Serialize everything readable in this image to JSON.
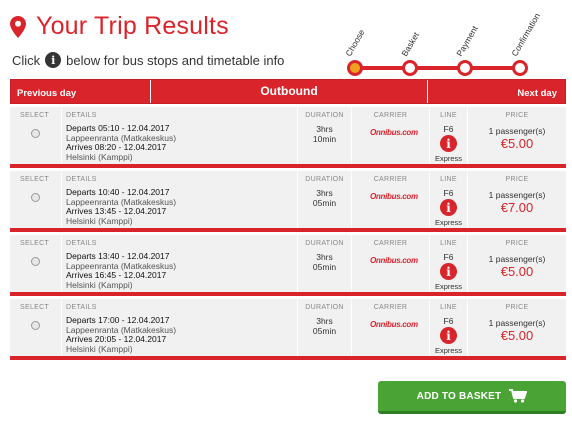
{
  "page": {
    "title": "Your Trip Results",
    "hint_before": "Click",
    "hint_after": "below for bus stops and timetable info",
    "hint_icon": "info-icon"
  },
  "progress": {
    "steps": [
      "Choose",
      "Basket",
      "Payment",
      "Confirmation"
    ],
    "active_step": "Choose",
    "accent": "#d9242b",
    "active_fill": "#f0a020"
  },
  "nav": {
    "prev": "Previous day",
    "title": "Outbound",
    "next": "Next day"
  },
  "headers": {
    "select": "SELECT",
    "details": "DETAILS",
    "duration": "DURATION",
    "carrier": "CARRIER",
    "line": "LINE",
    "price": "PRICE"
  },
  "trips": [
    {
      "depart": "Departs 05:10 - 12.04.2017",
      "from": "Lappeenranta (Matkakeskus)",
      "arrive": "Arrives 08:20 - 12.04.2017",
      "to": "Helsinki (Kamppi)",
      "dur_h": "3hrs",
      "dur_m": "10min",
      "carrier": "Onnibus.com",
      "line": "F6",
      "type": "Express",
      "pax": "1 passenger(s)",
      "price": "€5.00"
    },
    {
      "depart": "Departs 10:40 - 12.04.2017",
      "from": "Lappeenranta (Matkakeskus)",
      "arrive": "Arrives 13:45 - 12.04.2017",
      "to": "Helsinki (Kamppi)",
      "dur_h": "3hrs",
      "dur_m": "05min",
      "carrier": "Onnibus.com",
      "line": "F6",
      "type": "Express",
      "pax": "1 passenger(s)",
      "price": "€7.00"
    },
    {
      "depart": "Departs 13:40 - 12.04.2017",
      "from": "Lappeenranta (Matkakeskus)",
      "arrive": "Arrives 16:45 - 12.04.2017",
      "to": "Helsinki (Kamppi)",
      "dur_h": "3hrs",
      "dur_m": "05min",
      "carrier": "Onnibus.com",
      "line": "F6",
      "type": "Express",
      "pax": "1 passenger(s)",
      "price": "€5.00"
    },
    {
      "depart": "Departs 17:00 - 12.04.2017",
      "from": "Lappeenranta (Matkakeskus)",
      "arrive": "Arrives 20:05 - 12.04.2017",
      "to": "Helsinki (Kamppi)",
      "dur_h": "3hrs",
      "dur_m": "05min",
      "carrier": "Onnibus.com",
      "line": "F6",
      "type": "Express",
      "pax": "1 passenger(s)",
      "price": "€5.00"
    }
  ],
  "basket": {
    "label": "ADD TO BASKET",
    "icon": "cart-icon",
    "color": "#4aa435"
  }
}
